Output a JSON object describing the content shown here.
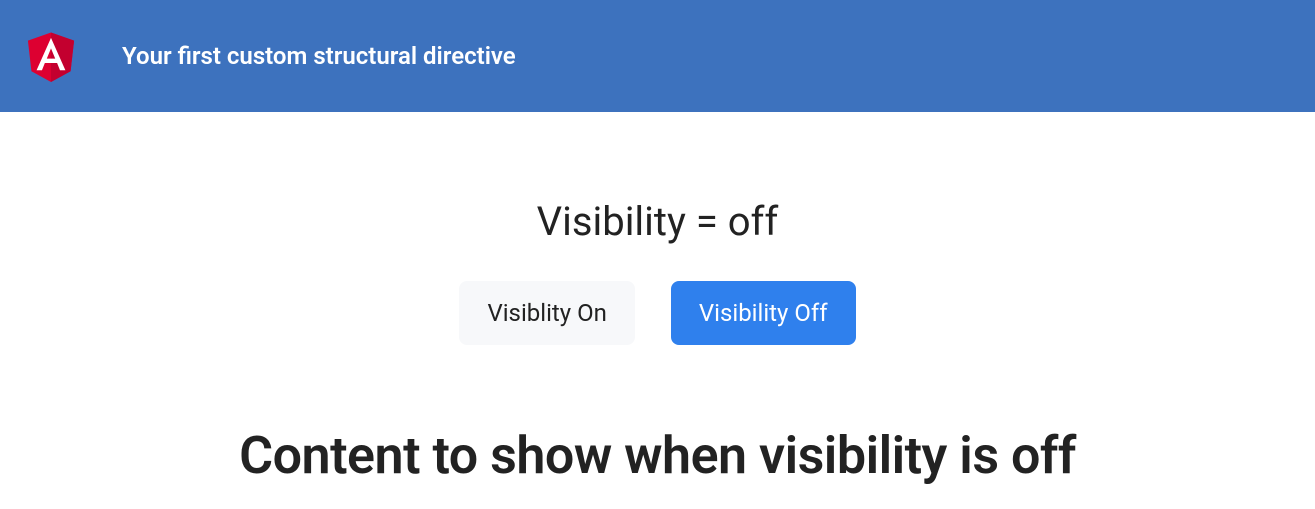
{
  "header": {
    "title": "Your first custom structural directive"
  },
  "main": {
    "status_label": "Visibility = off",
    "buttons": {
      "on_label": "Visiblity On",
      "off_label": "Visibility Off"
    },
    "content_heading": "Content to show when visibility is off"
  },
  "colors": {
    "header_bg": "#3d72be",
    "primary_btn": "#2f80ed",
    "light_btn": "#f7f8fa",
    "text_dark": "#222222"
  }
}
